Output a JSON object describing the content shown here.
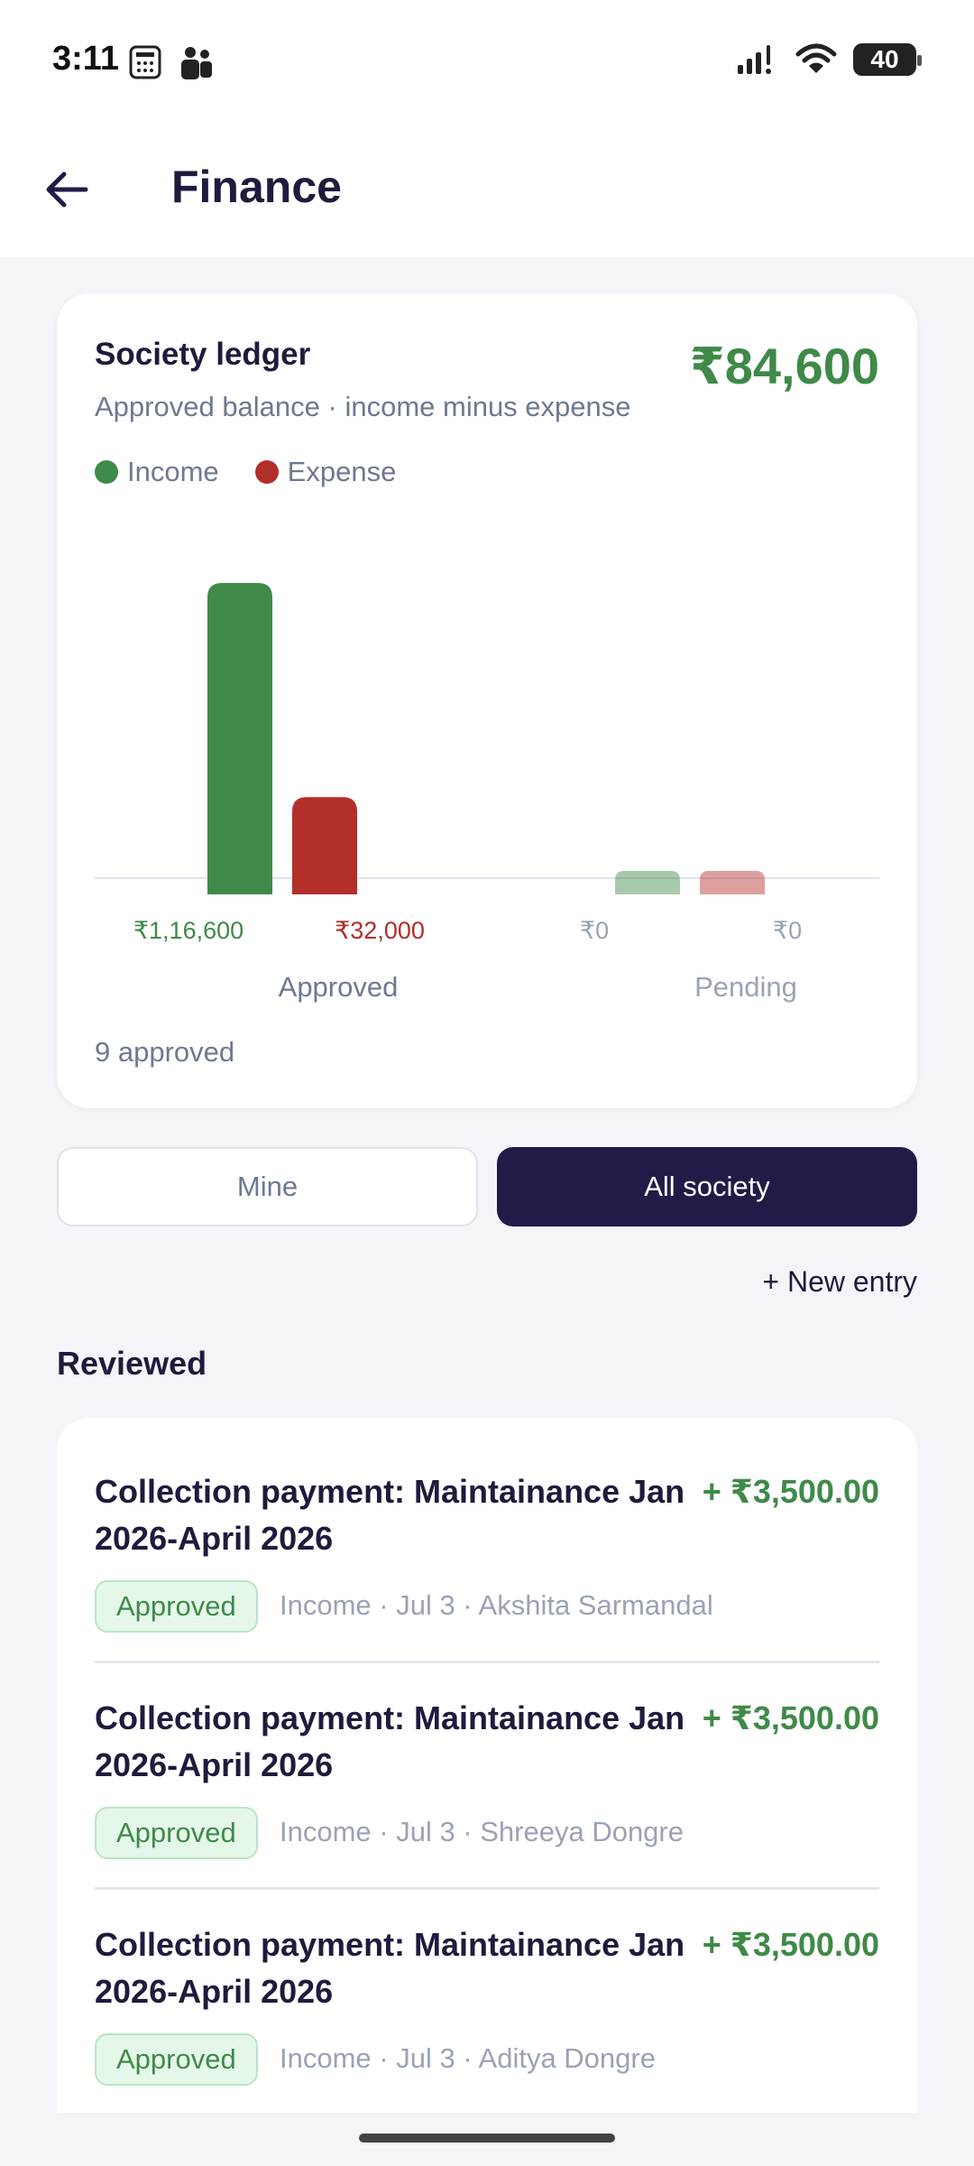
{
  "status_bar": {
    "time": "3:11",
    "battery": "40"
  },
  "header": {
    "title": "Finance"
  },
  "ledger": {
    "title": "Society ledger",
    "subtitle": "Approved balance · income minus expense",
    "balance": "₹84,600",
    "legend": [
      {
        "label": "Income",
        "color": "#3f8a48"
      },
      {
        "label": "Expense",
        "color": "#b22f2a"
      }
    ],
    "approved_count": "9 approved"
  },
  "chart_data": {
    "type": "bar",
    "categories": [
      "Approved",
      "Pending"
    ],
    "series": [
      {
        "name": "Income",
        "values": [
          116600,
          0
        ],
        "labels": [
          "₹1,16,600",
          "₹0"
        ],
        "color": "#3f8a48"
      },
      {
        "name": "Expense",
        "values": [
          32000,
          0
        ],
        "labels": [
          "₹32,000",
          "₹0"
        ],
        "color": "#b22f2a"
      }
    ],
    "ylim": [
      0,
      116600
    ],
    "legend": "top-left",
    "grid": false
  },
  "toggle": {
    "mine_label": "Mine",
    "all_label": "All society",
    "active": "All society"
  },
  "new_entry_label": "+ New entry",
  "reviewed": {
    "title": "Reviewed",
    "entries": [
      {
        "title": "Collection payment: Maintainance Jan 2026-April 2026",
        "amount": "+ ₹3,500.00",
        "status": "Approved",
        "meta": "Income · Jul 3 · Akshita Sarmandal"
      },
      {
        "title": "Collection payment: Maintainance Jan 2026-April 2026",
        "amount": "+ ₹3,500.00",
        "status": "Approved",
        "meta": "Income · Jul 3 · Shreeya Dongre"
      },
      {
        "title": "Collection payment: Maintainance Jan 2026-April 2026",
        "amount": "+ ₹3,500.00",
        "status": "Approved",
        "meta": "Income · Jul 3 · Aditya Dongre"
      }
    ]
  }
}
